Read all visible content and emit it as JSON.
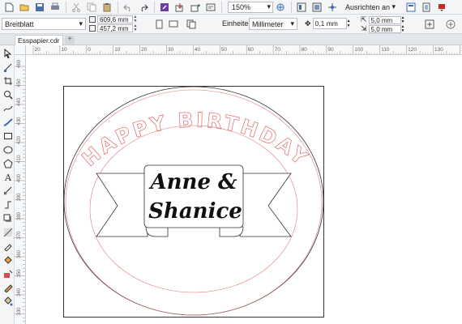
{
  "toolbar": {
    "zoom": "150%",
    "align_label": "Ausrichten an"
  },
  "property_bar": {
    "page_size": "Breitblatt",
    "width": "609,6 mm",
    "height": "457,2 mm",
    "units_label": "Einheiten:",
    "units_value": "Millimeter",
    "nudge": "0,1 mm",
    "dup_x": "5,0 mm",
    "dup_y": "5,0 mm"
  },
  "tabs": [
    {
      "label": "Esspapier.cdr"
    }
  ],
  "ruler": {
    "h_labels": [
      "20",
      "10",
      "0",
      "10",
      "20",
      "30",
      "40",
      "50",
      "60",
      "70",
      "80",
      "90",
      "100",
      "110",
      "120",
      "130",
      "140"
    ],
    "v_labels": [
      "460",
      "450",
      "440",
      "430",
      "420",
      "410",
      "400",
      "390",
      "380",
      "370",
      "360",
      "350",
      "340",
      "330",
      "320"
    ]
  },
  "artwork": {
    "arc_text": "HAPPY BIRTHDAY",
    "name_line1": "Anne &",
    "name_line2": "Shanice",
    "colors": {
      "outline": "#333333",
      "cut_red": "#e07a7a",
      "arc_text_stroke": "#e06a6a"
    }
  }
}
